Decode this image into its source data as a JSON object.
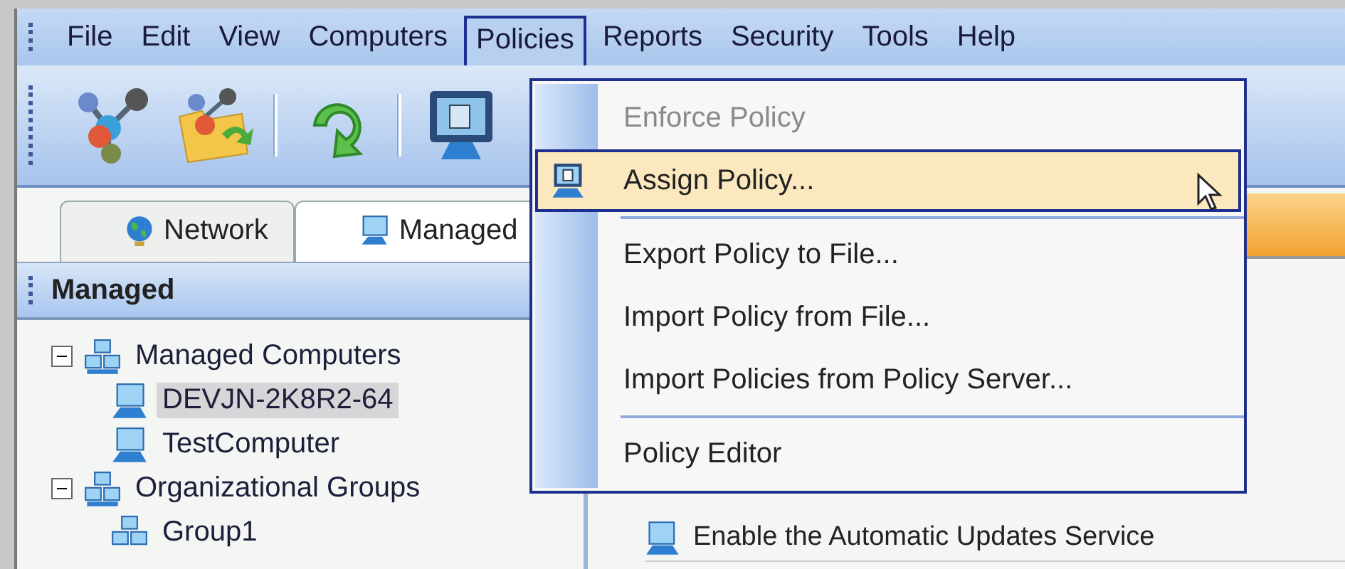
{
  "menu_bar": [
    {
      "label": "File",
      "selected": false
    },
    {
      "label": "Edit",
      "selected": false
    },
    {
      "label": "View",
      "selected": false
    },
    {
      "label": "Computers",
      "selected": false
    },
    {
      "label": "Policies",
      "selected": true
    },
    {
      "label": "Reports",
      "selected": false
    },
    {
      "label": "Security",
      "selected": false
    },
    {
      "label": "Tools",
      "selected": false
    },
    {
      "label": "Help",
      "selected": false
    }
  ],
  "toolbar": [
    {
      "kind": "network"
    },
    {
      "kind": "folder"
    },
    {
      "kind": "sep"
    },
    {
      "kind": "refresh"
    },
    {
      "kind": "sep"
    },
    {
      "kind": "monitor"
    }
  ],
  "tabs": [
    {
      "label": "Network",
      "kind": "globe",
      "selected": false
    },
    {
      "label": "Managed",
      "kind": "monitor",
      "selected": true
    }
  ],
  "panel_header": "Managed",
  "tree": [
    {
      "label": "Managed Computers",
      "kind": "group",
      "expanded": true,
      "selected": false,
      "children": [
        {
          "label": "DEVJN-2K8R2-64",
          "kind": "computer",
          "selected": true
        },
        {
          "label": "TestComputer",
          "kind": "computer",
          "selected": false
        }
      ]
    },
    {
      "label": "Organizational Groups",
      "kind": "group",
      "expanded": true,
      "selected": false,
      "children": [
        {
          "label": "Group1",
          "kind": "group",
          "selected": false
        }
      ]
    }
  ],
  "right_list": [
    {
      "label": "Enable the Automatic Updates Service"
    }
  ],
  "dropdown": [
    {
      "kind": "item",
      "label": "Enforce Policy",
      "disabled": true,
      "selected": false
    },
    {
      "kind": "icon_item",
      "label": "Assign Policy...",
      "disabled": false,
      "selected": true
    },
    {
      "kind": "separator"
    },
    {
      "kind": "item",
      "label": "Export Policy to File...",
      "disabled": false,
      "selected": false
    },
    {
      "kind": "item",
      "label": "Import Policy from File...",
      "disabled": false,
      "selected": false
    },
    {
      "kind": "item",
      "label": "Import Policies from Policy Server...",
      "disabled": false,
      "selected": false
    },
    {
      "kind": "separator"
    },
    {
      "kind": "item",
      "label": "Policy Editor",
      "disabled": false,
      "selected": false
    }
  ]
}
